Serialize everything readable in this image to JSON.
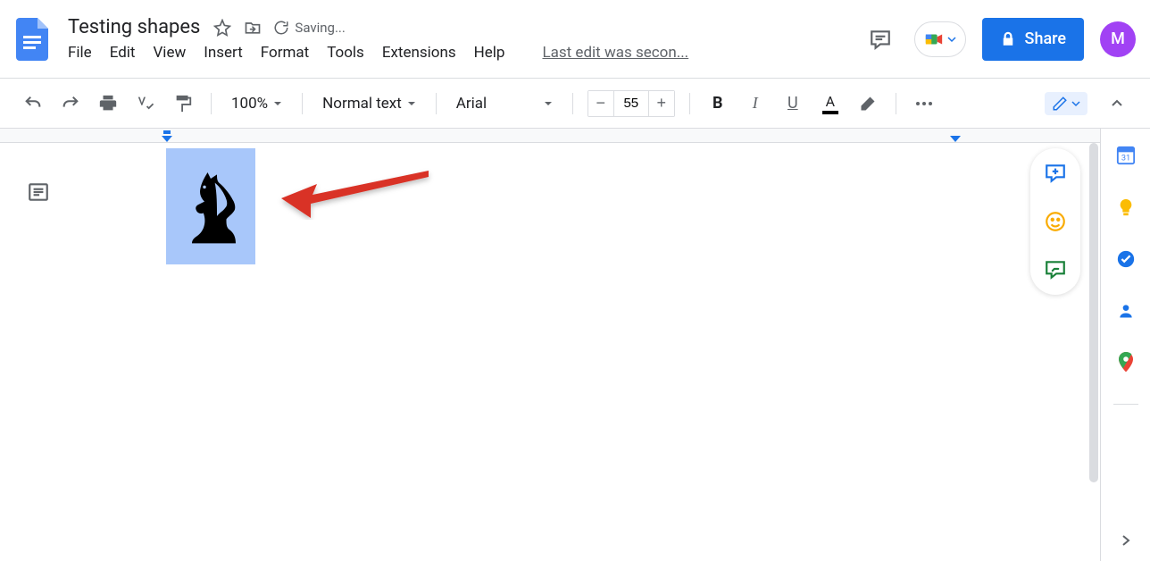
{
  "header": {
    "doc_title": "Testing shapes",
    "saving_text": "Saving...",
    "last_edit": "Last edit was secon...",
    "share_label": "Share",
    "avatar_letter": "M"
  },
  "menubar": {
    "items": [
      "File",
      "Edit",
      "View",
      "Insert",
      "Format",
      "Tools",
      "Extensions",
      "Help"
    ]
  },
  "toolbar": {
    "zoom": "100%",
    "style": "Normal text",
    "font": "Arial",
    "font_size": "55"
  },
  "colors": {
    "primary": "#1a73e8",
    "selection": "#a8c7fa",
    "avatar": "#a142f4"
  }
}
